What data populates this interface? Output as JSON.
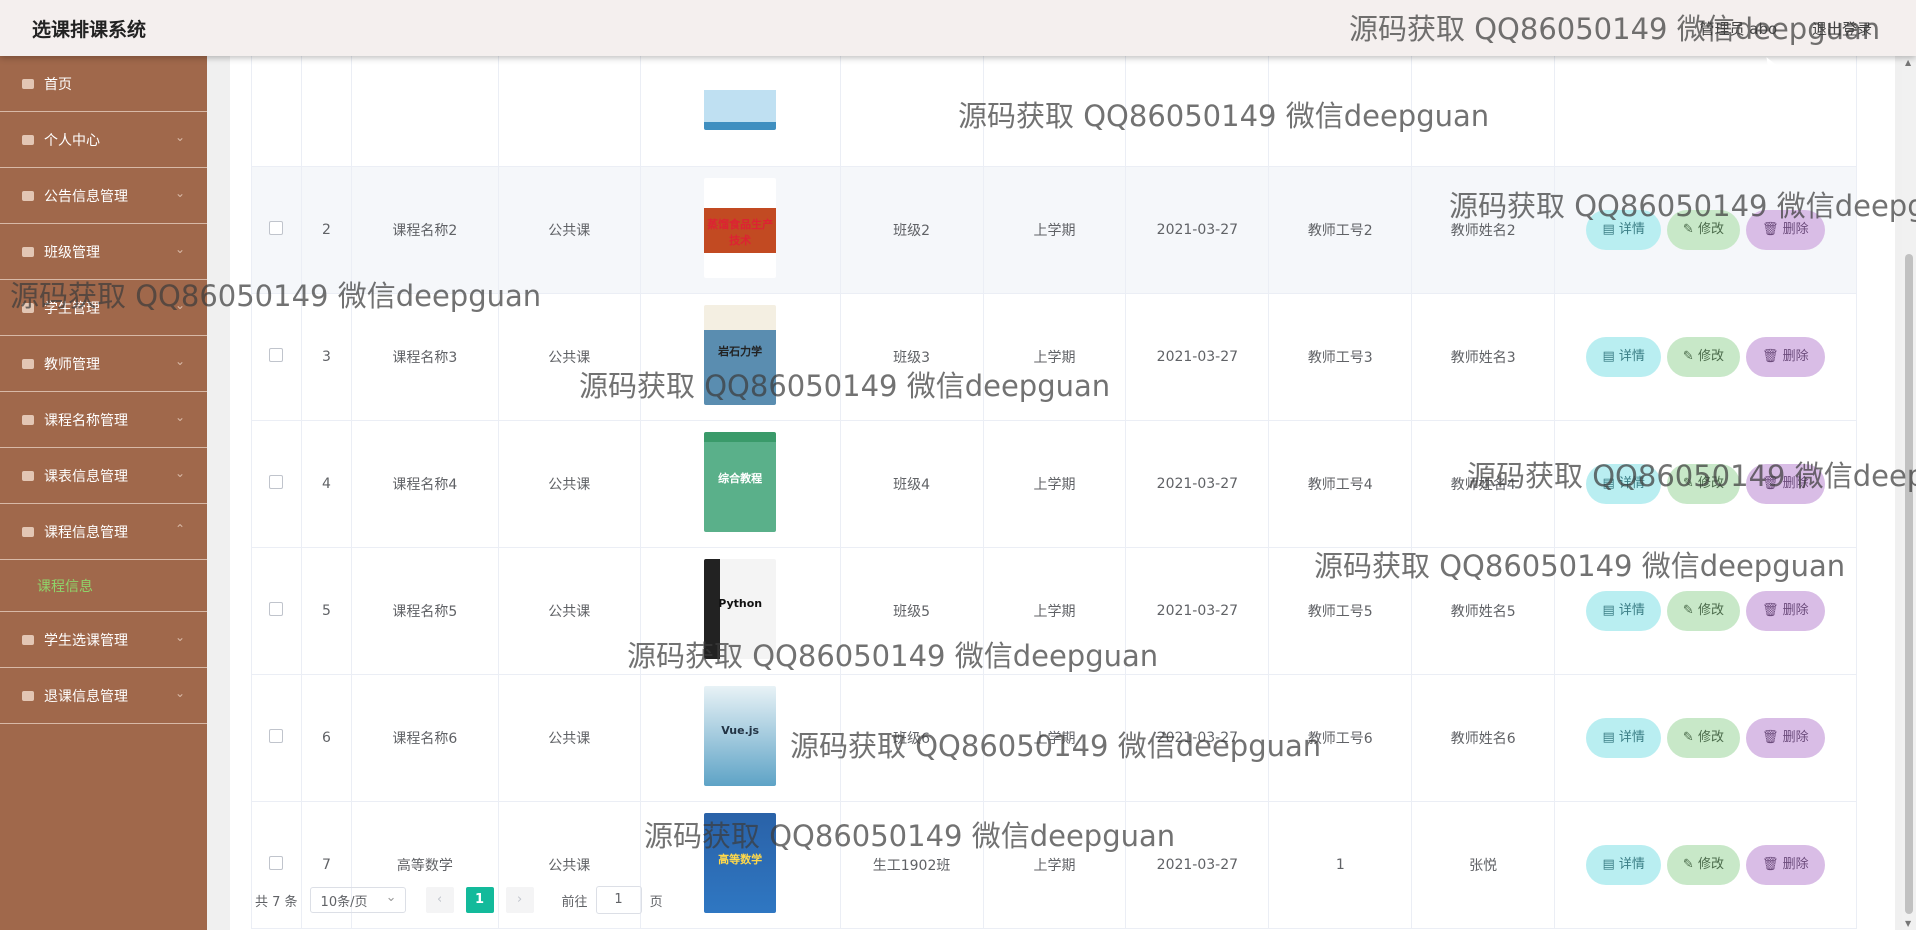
{
  "header": {
    "title": "选课排课系统",
    "user": "管理员 abo",
    "logout": "退出登录"
  },
  "sidebar": {
    "items": [
      {
        "label": "首页"
      },
      {
        "label": "个人中心"
      },
      {
        "label": "公告信息管理"
      },
      {
        "label": "班级管理"
      },
      {
        "label": "学生管理"
      },
      {
        "label": "教师管理"
      },
      {
        "label": "课程名称管理"
      },
      {
        "label": "课表信息管理"
      },
      {
        "label": "课程信息管理"
      }
    ],
    "sub": {
      "label": "课程信息"
    },
    "items2": [
      {
        "label": "学生选课管理"
      },
      {
        "label": "退课信息管理"
      }
    ]
  },
  "rows": [
    {
      "index": "",
      "name": "",
      "type": "",
      "cover": "light",
      "class": "",
      "term": "",
      "date": "",
      "teacher_no": "",
      "teacher_name": ""
    },
    {
      "index": "2",
      "name": "课程名称2",
      "type": "公共课",
      "cover": "red",
      "cover_title": "蒸馏食品生产技术",
      "class": "班级2",
      "term": "上学期",
      "date": "2021-03-27",
      "teacher_no": "教师工号2",
      "teacher_name": "教师姓名2"
    },
    {
      "index": "3",
      "name": "课程名称3",
      "type": "公共课",
      "cover": "stone",
      "cover_title": "岩石力学",
      "class": "班级3",
      "term": "上学期",
      "date": "2021-03-27",
      "teacher_no": "教师工号3",
      "teacher_name": "教师姓名3"
    },
    {
      "index": "4",
      "name": "课程名称4",
      "type": "公共课",
      "cover": "green",
      "cover_title": "综合教程",
      "class": "班级4",
      "term": "上学期",
      "date": "2021-03-27",
      "teacher_no": "教师工号4",
      "teacher_name": "教师姓名4"
    },
    {
      "index": "5",
      "name": "课程名称5",
      "type": "公共课",
      "cover": "python",
      "cover_title": "Python",
      "class": "班级5",
      "term": "上学期",
      "date": "2021-03-27",
      "teacher_no": "教师工号5",
      "teacher_name": "教师姓名5"
    },
    {
      "index": "6",
      "name": "课程名称6",
      "type": "公共课",
      "cover": "vue",
      "cover_title": "Vue.js",
      "class": "班级6",
      "term": "上学期",
      "date": "2021-03-27",
      "teacher_no": "教师工号6",
      "teacher_name": "教师姓名6"
    },
    {
      "index": "7",
      "name": "高等数学",
      "type": "公共课",
      "cover": "math",
      "cover_title": "高等数学",
      "class": "生工1902班",
      "term": "上学期",
      "date": "2021-03-27",
      "teacher_no": "1",
      "teacher_name": "张悦"
    }
  ],
  "actions": {
    "detail": "详情",
    "edit": "修改",
    "delete": "删除"
  },
  "pager": {
    "total": "共 7 条",
    "page_size": "10条/页",
    "current": "1",
    "goto_label": "前往",
    "goto_value": "1",
    "page_suffix": "页"
  },
  "watermark": "源码获取 QQ86050149 微信deepguan"
}
